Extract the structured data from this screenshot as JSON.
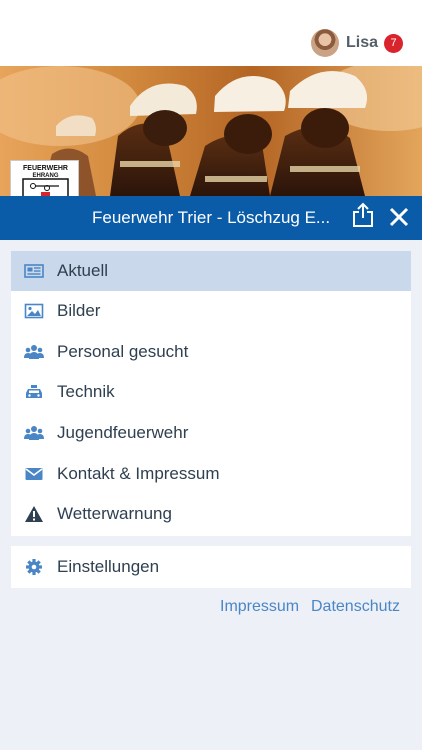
{
  "header": {
    "user_name": "Lisa",
    "notification_count": "7"
  },
  "logo": {
    "text_line1": "FEUERWEHR",
    "text_line2": "EHRANG"
  },
  "titlebar": {
    "title": "Feuerwehr Trier - Löschzug E..."
  },
  "menu": {
    "items": [
      {
        "label": "Aktuell",
        "icon": "newspaper-icon",
        "active": true
      },
      {
        "label": "Bilder",
        "icon": "image-icon"
      },
      {
        "label": "Personal gesucht",
        "icon": "users-icon"
      },
      {
        "label": "Technik",
        "icon": "vehicle-icon"
      },
      {
        "label": "Jugendfeuerwehr",
        "icon": "users-icon"
      },
      {
        "label": "Kontakt & Impressum",
        "icon": "envelope-icon"
      },
      {
        "label": "Wetterwarnung",
        "icon": "warning-icon"
      }
    ]
  },
  "settings": {
    "label": "Einstellungen",
    "icon": "gear-icon"
  },
  "footer": {
    "impressum": "Impressum",
    "datenschutz": "Datenschutz"
  },
  "colors": {
    "brand_blue": "#0b5ca8",
    "icon_blue": "#4a86c5",
    "active_bg": "#c9d8ea",
    "badge_red": "#d9232d"
  }
}
